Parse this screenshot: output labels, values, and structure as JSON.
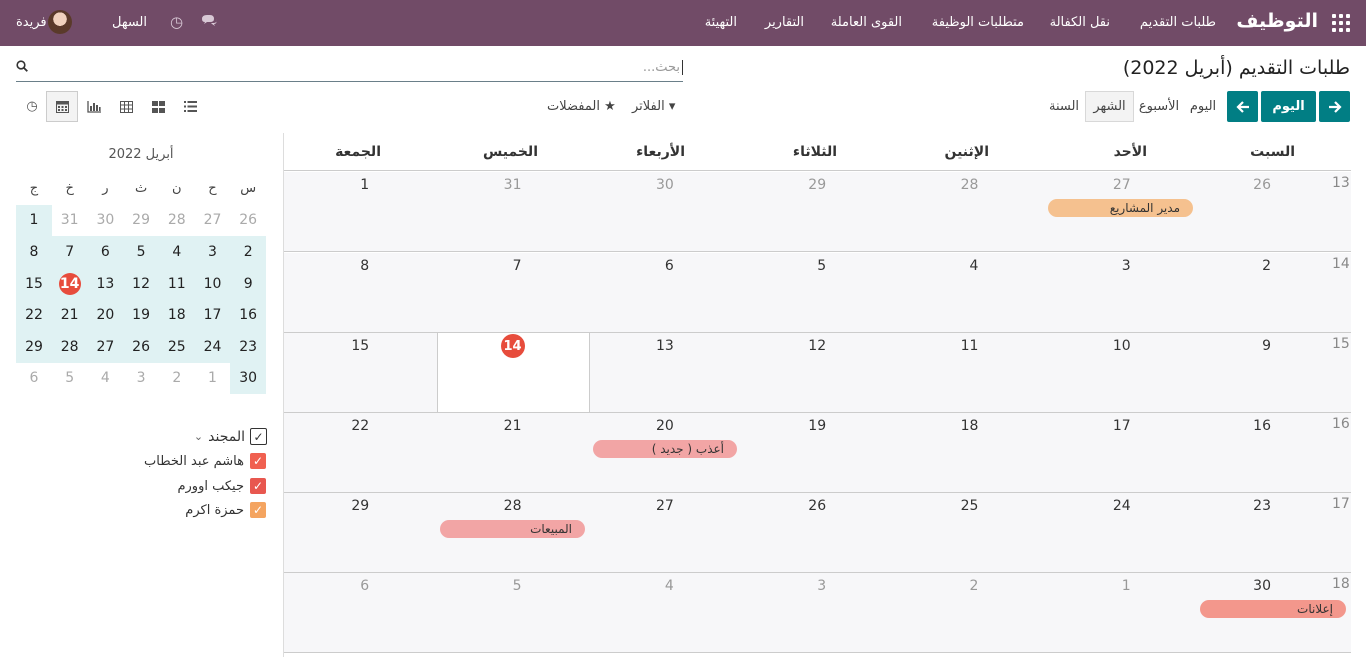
{
  "nav": {
    "brand": "التوظيف",
    "menu": [
      "طلبات التقديم",
      "نقل الكفالة",
      "متطلبات الوظيفة",
      "القوى العاملة",
      "التقارير",
      "التهيئة"
    ],
    "company": "السهل",
    "user": "فريدة"
  },
  "control": {
    "title": "طلبات التقديم (أبريل 2022)",
    "search_placeholder": "بحث...",
    "today_label": "اليوم",
    "scales": [
      "اليوم",
      "الأسبوع",
      "الشهر",
      "السنة"
    ],
    "active_scale": "الشهر",
    "filters_label": "الفلاتر",
    "favorites_label": "المفضلات"
  },
  "mini_calendar": {
    "title": "أبريل 2022",
    "weekdays": [
      "س",
      "ح",
      "ن",
      "ث",
      "ر",
      "خ",
      "ج"
    ],
    "weeks": [
      [
        "26",
        "27",
        "28",
        "29",
        "30",
        "31",
        "1"
      ],
      [
        "2",
        "3",
        "4",
        "5",
        "6",
        "7",
        "8"
      ],
      [
        "9",
        "10",
        "11",
        "12",
        "13",
        "14",
        "15"
      ],
      [
        "16",
        "17",
        "18",
        "19",
        "20",
        "21",
        "22"
      ],
      [
        "23",
        "24",
        "25",
        "26",
        "27",
        "28",
        "29"
      ],
      [
        "30",
        "1",
        "2",
        "3",
        "4",
        "5",
        "6"
      ]
    ],
    "today": "14"
  },
  "filter_list": {
    "group_label": "المجند",
    "items": [
      {
        "name": "هاشم عبد الخطاب",
        "color": "#f06050"
      },
      {
        "name": "جيكب اوورم",
        "color": "#e8574f"
      },
      {
        "name": "حمزة اكرم",
        "color": "#f4a460"
      }
    ]
  },
  "calendar": {
    "day_headers": [
      "السبت",
      "الأحد",
      "الإثنين",
      "الثلاثاء",
      "الأربعاء",
      "الخميس",
      "الجمعة"
    ],
    "weeks": [
      {
        "num": "13",
        "days": [
          "26",
          "27",
          "28",
          "29",
          "30",
          "31",
          "1"
        ]
      },
      {
        "num": "14",
        "days": [
          "2",
          "3",
          "4",
          "5",
          "6",
          "7",
          "8"
        ]
      },
      {
        "num": "15",
        "days": [
          "9",
          "10",
          "11",
          "12",
          "13",
          "14",
          "15"
        ]
      },
      {
        "num": "16",
        "days": [
          "16",
          "17",
          "18",
          "19",
          "20",
          "21",
          "22"
        ]
      },
      {
        "num": "17",
        "days": [
          "23",
          "24",
          "25",
          "26",
          "27",
          "28",
          "29"
        ]
      },
      {
        "num": "18",
        "days": [
          "30",
          "1",
          "2",
          "3",
          "4",
          "5",
          "6"
        ]
      }
    ],
    "events": [
      {
        "title": "مدير المشاريع",
        "color": "#f5c18f"
      },
      {
        "title": "أعذب ( جديد )",
        "color": "#f2a5a5"
      },
      {
        "title": "المبيعات",
        "color": "#f2a5a5"
      },
      {
        "title": "إعلانات",
        "color": "#f3978c"
      }
    ]
  }
}
